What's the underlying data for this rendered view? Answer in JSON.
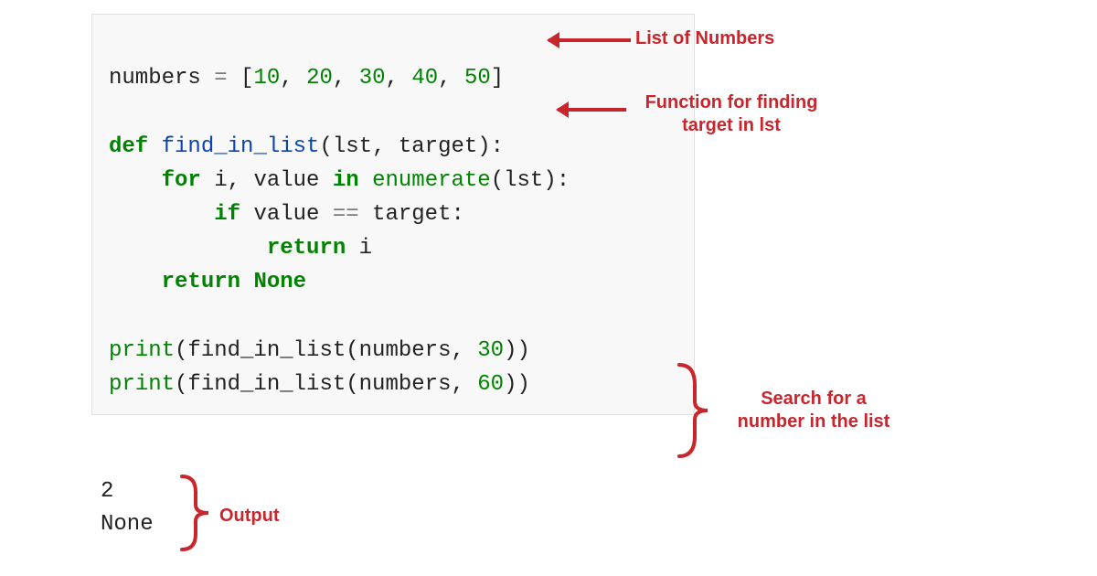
{
  "code": {
    "l1": {
      "var": "numbers ",
      "eq": "=",
      "sp": " ",
      "lb": "[",
      "n1": "10",
      "c1": ", ",
      "n2": "20",
      "c2": ", ",
      "n3": "30",
      "c3": ", ",
      "n4": "40",
      "c4": ", ",
      "n5": "50",
      "rb": "]"
    },
    "l3": {
      "kw": "def",
      "sp": " ",
      "fn": "find_in_list",
      "p": "(lst, target):"
    },
    "l4": {
      "ind": "    ",
      "kw": "for",
      "sp1": " ",
      "v": "i, value ",
      "kw2": "in",
      "sp2": " ",
      "fn": "enumerate",
      "p": "(lst):"
    },
    "l5": {
      "ind": "        ",
      "kw": "if",
      "sp": " ",
      "v": "value ",
      "op": "==",
      "t": " target:"
    },
    "l6": {
      "ind": "            ",
      "kw": "return",
      "sp": " ",
      "v": "i"
    },
    "l7": {
      "ind": "    ",
      "kw": "return",
      "sp": " ",
      "none": "None"
    },
    "l9": {
      "fn": "print",
      "p1": "(find_in_list(numbers, ",
      "n": "30",
      "p2": "))"
    },
    "l10": {
      "fn": "print",
      "p1": "(find_in_list(numbers, ",
      "n": "60",
      "p2": "))"
    }
  },
  "output": {
    "line1": "2",
    "line2": "None"
  },
  "annotations": {
    "list_of_numbers": "List of Numbers",
    "function_finding_l1": "Function for finding",
    "function_finding_l2": "target in lst",
    "search_l1": "Search for a",
    "search_l2": "number in the list",
    "output_label": "Output"
  }
}
